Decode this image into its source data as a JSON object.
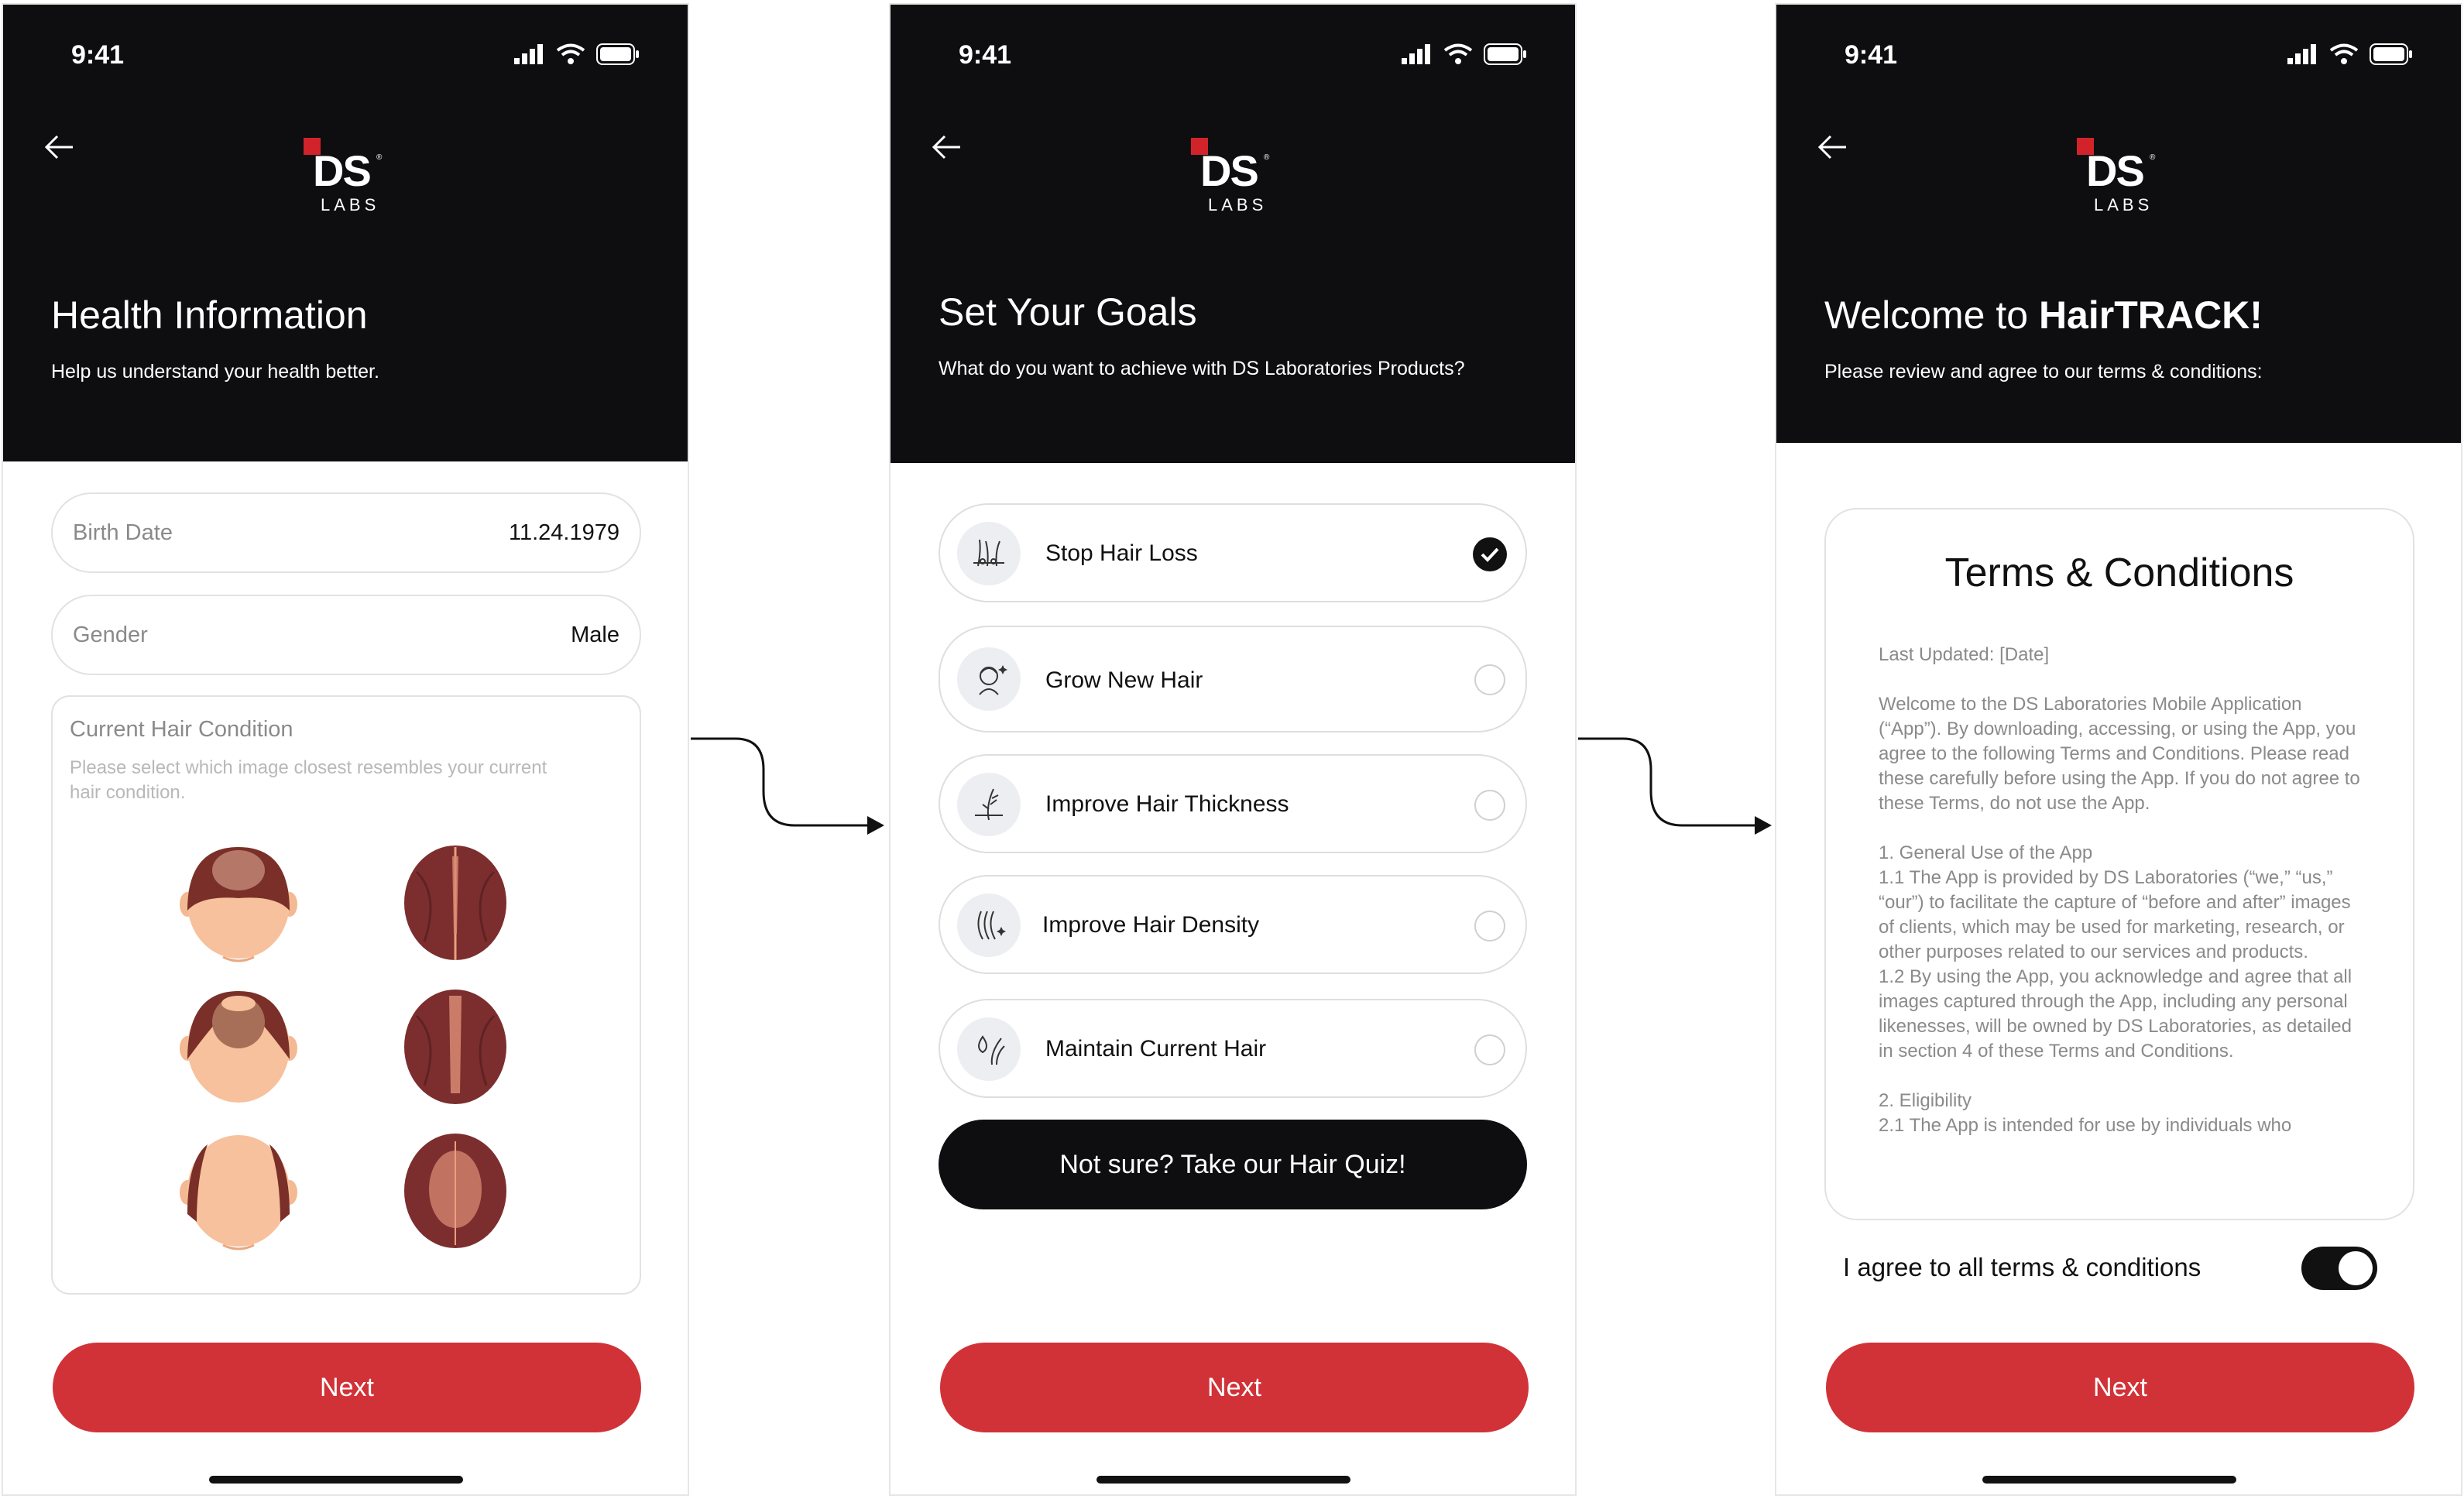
{
  "status": {
    "time": "9:41"
  },
  "brand": {
    "mark": "DS",
    "sub": "LABS",
    "reg": "®"
  },
  "screen1": {
    "title": "Health Information",
    "subtitle": "Help us understand your health better.",
    "birth": {
      "label": "Birth Date",
      "value": "11.24.1979"
    },
    "gender": {
      "label": "Gender",
      "value": "Male"
    },
    "hair": {
      "title": "Current Hair Condition",
      "hint": "Please select which image closest resembles your current hair condition."
    },
    "next": "Next"
  },
  "screen2": {
    "title": "Set Your Goals",
    "subtitle": "What do you want to achieve with DS Laboratories Products?",
    "goals": [
      {
        "label": "Stop Hair Loss",
        "icon": "hair-follicle-icon",
        "selected": true
      },
      {
        "label": "Grow New Hair",
        "icon": "head-sparkle-icon",
        "selected": false
      },
      {
        "label": "Improve Hair Thickness",
        "icon": "hair-strand-icon",
        "selected": false
      },
      {
        "label": "Improve Hair Density",
        "icon": "hair-waves-icon",
        "selected": false
      },
      {
        "label": "Maintain Current Hair",
        "icon": "hair-drop-icon",
        "selected": false
      }
    ],
    "quiz": "Not sure? Take our Hair Quiz!",
    "next": "Next"
  },
  "screen3": {
    "title_prefix": "Welcome to ",
    "title_bold": "HairTRACK!",
    "subtitle": "Please review and agree to our terms & conditions:",
    "terms": {
      "title": "Terms & Conditions",
      "updated": "Last Updated: [Date]",
      "p1": "Welcome to the DS Laboratories Mobile Application (“App”). By downloading, accessing, or using the App, you agree to the following Terms and Conditions. Please read these carefully before using the App. If you do not agree to these Terms, do not use the App.",
      "p2": "1. General Use of the App\n1.1 The App is provided by DS Laboratories (“we,” “us,” “our”) to facilitate the capture of “before and after” images of clients, which may be used for marketing, research, or other purposes related to our services and products.\n1.2 By using the App, you acknowledge and agree that all images captured through the App, including any personal likenesses, will be owned by DS Laboratories, as detailed in section 4 of these Terms and Conditions.",
      "p3": "2. Eligibility\n2.1 The App is intended for use by individuals who"
    },
    "agree": "I agree to all terms & conditions",
    "agree_on": true,
    "next": "Next"
  },
  "colors": {
    "accent": "#d13237",
    "header": "#0e0d10",
    "brand_red": "#d2232a"
  }
}
